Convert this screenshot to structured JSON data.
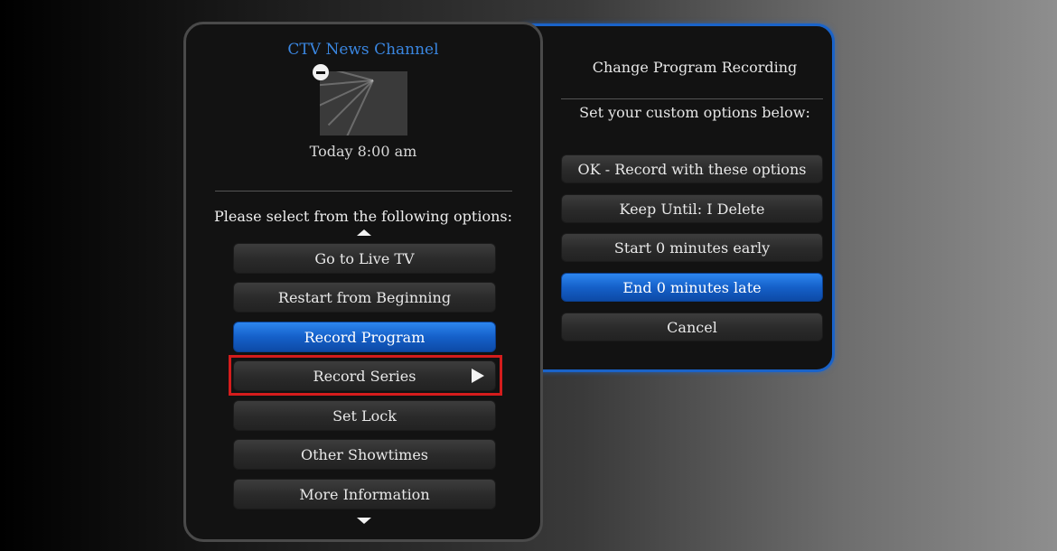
{
  "channel": {
    "name": "CTV News Channel",
    "airtime": "Today 8:00 am"
  },
  "left_menu": {
    "prompt": "Please select from the following options:",
    "items": [
      {
        "label": "Go to Live TV",
        "selected": false
      },
      {
        "label": "Restart from Beginning",
        "selected": false
      },
      {
        "label": "Record Program",
        "selected": true
      },
      {
        "label": "Record Series",
        "selected": false,
        "highlighted": true
      },
      {
        "label": "Set Lock",
        "selected": false
      },
      {
        "label": "Other Showtimes",
        "selected": false
      },
      {
        "label": "More Information",
        "selected": false
      }
    ]
  },
  "right_panel": {
    "title": "Change Program Recording",
    "subtitle": "Set your custom options below:",
    "items": [
      {
        "label": "OK - Record with these options",
        "selected": false
      },
      {
        "label": "Keep Until: I Delete",
        "selected": false
      },
      {
        "label": "Start 0 minutes early",
        "selected": false
      },
      {
        "label": "End 0 minutes late",
        "selected": true
      },
      {
        "label": "Cancel",
        "selected": false
      }
    ]
  },
  "colors": {
    "accent_blue": "#1560c9",
    "channel_text": "#3a86e0",
    "highlight_red": "#d41c1c"
  },
  "icons": [
    "minus-circle-icon",
    "up-arrow-icon",
    "down-arrow-icon",
    "play-arrow-icon"
  ]
}
